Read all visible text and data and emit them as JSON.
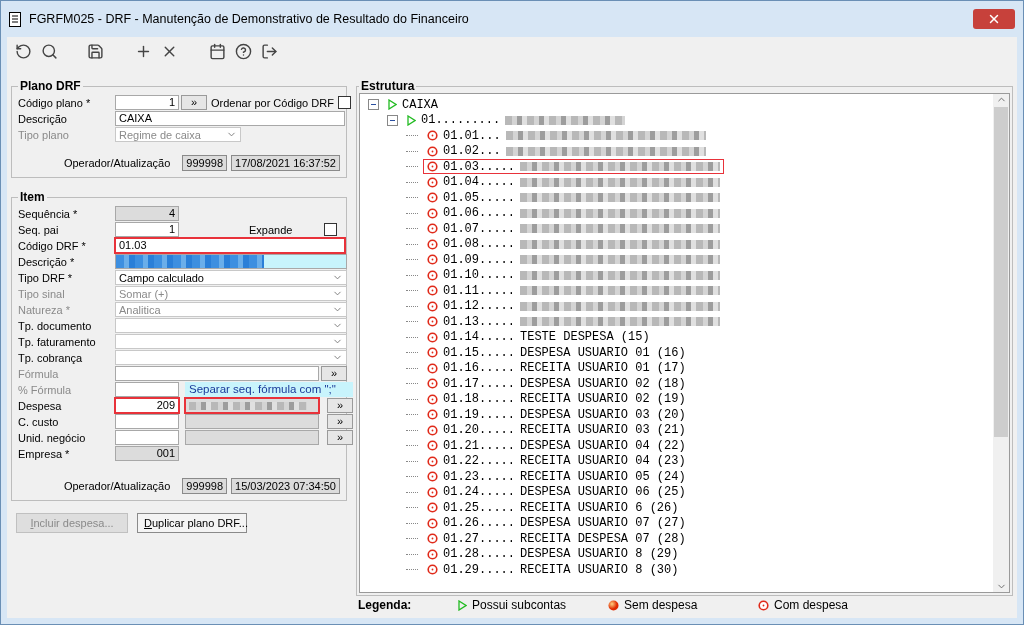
{
  "window": {
    "title": "FGRFM025 - DRF - Manutenção de Demonstrativo de Resultado do Financeiro"
  },
  "plano": {
    "title": "Plano DRF",
    "codigo_label": "Código plano *",
    "codigo": "1",
    "lookup_button": "»",
    "order_label": "Ordenar por Código DRF",
    "order_checked": false,
    "descricao_label": "Descrição",
    "descricao": "CAIXA",
    "tipo_label": "Tipo plano",
    "tipo": "Regime de caixa",
    "tipo_disabled": true,
    "operador_label": "Operador/Atualização",
    "operador": "999998",
    "atualizacao": "17/08/2021 16:37:52"
  },
  "item": {
    "title": "Item",
    "fields": [
      {
        "kind": "number",
        "label": "Sequência *",
        "value": "4",
        "readonly": true,
        "disabled": false,
        "highlighted": false
      },
      {
        "kind": "number",
        "label": "Seq. pai",
        "value": "1",
        "readonly": false,
        "disabled": false,
        "highlighted": false,
        "check_label": "Expande",
        "checked": false
      },
      {
        "kind": "text",
        "label": "Código DRF *",
        "value": "01.03",
        "disabled": false,
        "highlighted": true
      },
      {
        "kind": "redacted",
        "label": "Descrição *",
        "disabled": false,
        "highlighted": false
      },
      {
        "kind": "select",
        "label": "Tipo DRF *",
        "value": "Campo calculado",
        "disabled": false,
        "highlighted": false
      },
      {
        "kind": "select",
        "label": "Tipo sinal",
        "value": "Somar (+)",
        "disabled": true,
        "highlighted": false
      },
      {
        "kind": "select",
        "label": "Natureza *",
        "value": "Analitica",
        "disabled": true,
        "highlighted": false
      },
      {
        "kind": "select",
        "label": "Tp. documento",
        "disabled": false,
        "highlighted": false
      },
      {
        "kind": "select",
        "label": "Tp. faturamento",
        "disabled": false,
        "highlighted": false
      },
      {
        "kind": "select",
        "label": "Tp. cobrança",
        "disabled": false,
        "highlighted": false
      },
      {
        "kind": "formula",
        "label": "Fórmula",
        "button": "»",
        "disabled": true,
        "highlighted": false
      },
      {
        "kind": "percent",
        "label": "% Fórmula",
        "hint": "Separar seq. fórmula com \";\"",
        "disabled": true,
        "highlighted": false
      },
      {
        "kind": "lookup",
        "label": "Despesa",
        "value": "209",
        "button": "»",
        "redacted": true,
        "disabled": false,
        "highlighted": true
      },
      {
        "kind": "lookup",
        "label": "C. custo",
        "button": "»",
        "redacted": false,
        "disabled": false,
        "highlighted": false
      },
      {
        "kind": "lookup",
        "label": "Unid. negócio",
        "button": "»",
        "redacted": false,
        "disabled": false,
        "highlighted": false
      },
      {
        "kind": "number",
        "label": "Empresa *",
        "value": "001",
        "readonly": true,
        "disabled": false,
        "highlighted": false
      }
    ],
    "operador_label": "Operador/Atualização",
    "operador": "999998",
    "atualizacao": "15/03/2023 07:34:50"
  },
  "buttons": [
    {
      "label": "Incluir despesa...",
      "disabled": true
    },
    {
      "label": "Duplicar plano DRF...",
      "disabled": false
    }
  ],
  "estrutura": {
    "title": "Estrutura",
    "tree": [
      {
        "kind": "subaccounts",
        "code": "CAIXA",
        "expanded": true,
        "selected": false,
        "children": [
          {
            "kind": "subaccounts",
            "code": "01.........",
            "redacted": true,
            "expanded": true,
            "selected": false,
            "children": [
              {
                "kind": "expense",
                "code": "01.01...",
                "redacted": true,
                "selected": false
              },
              {
                "kind": "expense",
                "code": "01.02...",
                "redacted": true,
                "selected": false
              },
              {
                "kind": "expense",
                "code": "01.03.....",
                "redacted": true,
                "selected": true
              },
              {
                "kind": "expense",
                "code": "01.04.....",
                "redacted": true,
                "selected": false
              },
              {
                "kind": "expense",
                "code": "01.05.....",
                "redacted": true,
                "selected": false
              },
              {
                "kind": "expense",
                "code": "01.06.....",
                "redacted": true,
                "selected": false
              },
              {
                "kind": "expense",
                "code": "01.07.....",
                "redacted": true,
                "selected": false
              },
              {
                "kind": "expense",
                "code": "01.08.....",
                "redacted": true,
                "selected": false
              },
              {
                "kind": "expense",
                "code": "01.09.....",
                "redacted": true,
                "selected": false
              },
              {
                "kind": "expense",
                "code": "01.10.....",
                "redacted": true,
                "selected": false
              },
              {
                "kind": "expense",
                "code": "01.11.....",
                "redacted": true,
                "selected": false
              },
              {
                "kind": "expense",
                "code": "01.12.....",
                "redacted": true,
                "selected": false
              },
              {
                "kind": "expense",
                "code": "01.13.....",
                "redacted": true,
                "selected": false
              },
              {
                "kind": "expense",
                "code": "01.14.....",
                "label": "TESTE DESPESA (15)",
                "selected": false
              },
              {
                "kind": "expense",
                "code": "01.15.....",
                "label": "DESPESA USUARIO 01 (16)",
                "selected": false
              },
              {
                "kind": "expense",
                "code": "01.16.....",
                "label": "RECEITA USUARIO 01 (17)",
                "selected": false
              },
              {
                "kind": "expense",
                "code": "01.17.....",
                "label": "DESPESA USUARIO 02 (18)",
                "selected": false
              },
              {
                "kind": "expense",
                "code": "01.18.....",
                "label": "RECEITA USUARIO 02 (19)",
                "selected": false
              },
              {
                "kind": "expense",
                "code": "01.19.....",
                "label": "DESPESA USUARIO 03 (20)",
                "selected": false
              },
              {
                "kind": "expense",
                "code": "01.20.....",
                "label": "RECEITA USUARIO 03 (21)",
                "selected": false
              },
              {
                "kind": "expense",
                "code": "01.21.....",
                "label": "DESPESA USUARIO 04 (22)",
                "selected": false
              },
              {
                "kind": "expense",
                "code": "01.22.....",
                "label": "RECEITA USUARIO 04 (23)",
                "selected": false
              },
              {
                "kind": "expense",
                "code": "01.23.....",
                "label": "RECEITA USUARIO 05 (24)",
                "selected": false
              },
              {
                "kind": "expense",
                "code": "01.24.....",
                "label": "DESPESA USUARIO 06 (25)",
                "selected": false
              },
              {
                "kind": "expense",
                "code": "01.25.....",
                "label": "RECEITA USUARIO 6 (26)",
                "selected": false
              },
              {
                "kind": "expense",
                "code": "01.26.....",
                "label": "DESPESA USUARIO 07 (27)",
                "selected": false
              },
              {
                "kind": "expense",
                "code": "01.27.....",
                "label": "RECEITA DESPESA 07 (28)",
                "selected": false
              },
              {
                "kind": "expense",
                "code": "01.28.....",
                "label": "DESPESA USUARIO 8 (29)",
                "selected": false
              },
              {
                "kind": "expense",
                "code": "01.29.....",
                "label": "RECEITA USUARIO 8 (30)",
                "selected": false
              }
            ]
          }
        ]
      }
    ]
  },
  "legend": {
    "title": "Legenda:",
    "items": [
      {
        "kind": "subaccounts",
        "label": "Possui subcontas"
      },
      {
        "kind": "no-expense",
        "label": "Sem despesa"
      },
      {
        "kind": "expense",
        "label": "Com despesa"
      }
    ]
  }
}
